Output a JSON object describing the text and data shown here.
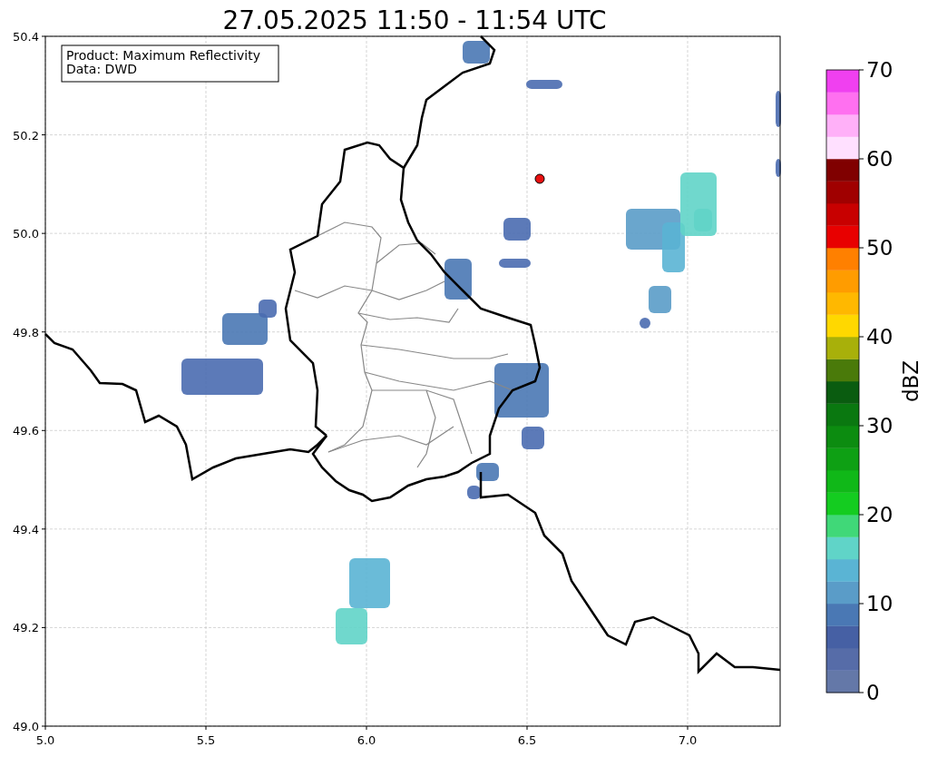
{
  "title": "27.05.2025 11:50 - 11:54 UTC",
  "map": {
    "info_box": [
      "Product: Maximum Reflectivity",
      "Data: DWD"
    ],
    "x_tick_labels": [
      "5.0",
      "5.5",
      "6.0",
      "6.5",
      "7.0"
    ],
    "y_tick_labels": [
      "50.4",
      "50.2",
      "50.0",
      "49.8",
      "49.6",
      "49.4",
      "49.2",
      "49.0"
    ]
  },
  "colorbar": {
    "label": "dBZ",
    "tick_labels": [
      "70",
      "60",
      "50",
      "40",
      "30",
      "20",
      "10",
      "0"
    ],
    "bins": [
      {
        "color": "#6478a8"
      },
      {
        "color": "#566ca8"
      },
      {
        "color": "#4660a4"
      },
      {
        "color": "#4a78b4"
      },
      {
        "color": "#5a9cc8"
      },
      {
        "color": "#5ab4d4"
      },
      {
        "color": "#60d4c8"
      },
      {
        "color": "#40d878"
      },
      {
        "color": "#14cc20"
      },
      {
        "color": "#10b818"
      },
      {
        "color": "#0ea014"
      },
      {
        "color": "#0c8c10"
      },
      {
        "color": "#0a7810"
      },
      {
        "color": "#0a5c10"
      },
      {
        "color": "#4a7a0a"
      },
      {
        "color": "#a8b00a"
      },
      {
        "color": "#ffd800"
      },
      {
        "color": "#ffb800"
      },
      {
        "color": "#ff9c00"
      },
      {
        "color": "#ff8000"
      },
      {
        "color": "#e80000"
      },
      {
        "color": "#c80000"
      },
      {
        "color": "#a00000"
      },
      {
        "color": "#800000"
      },
      {
        "color": "#ffe0ff"
      },
      {
        "color": "#ffb0f8"
      },
      {
        "color": "#ff70f0"
      },
      {
        "color": "#f040f0"
      }
    ]
  }
}
